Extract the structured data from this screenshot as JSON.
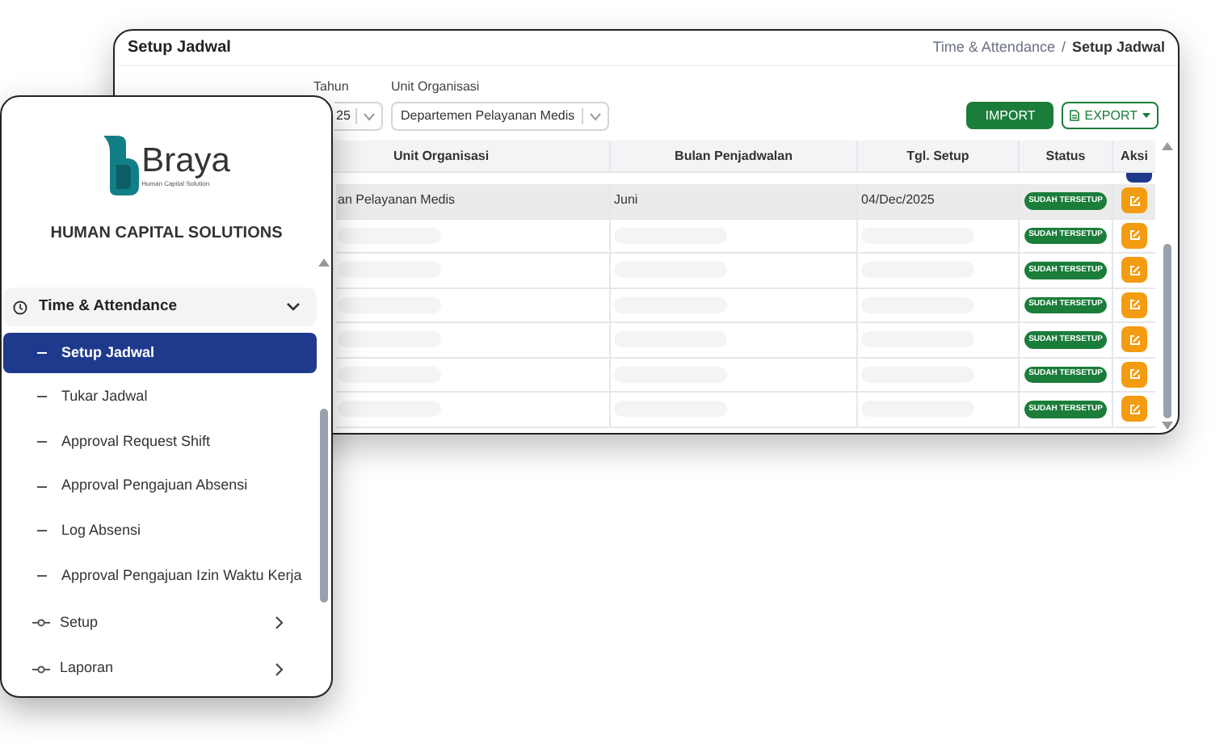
{
  "window": {
    "title": "Setup Jadwal"
  },
  "breadcrumb": {
    "items": [
      {
        "label": "Time & Attendance",
        "current": false
      },
      {
        "label": "Setup Jadwal",
        "current": true
      }
    ],
    "separator": "/"
  },
  "filters": [
    {
      "label": "Tahun",
      "value": "25"
    },
    {
      "label": "Unit Organisasi",
      "value": "Departemen Pelayanan Medis"
    }
  ],
  "actions": [
    {
      "kind": "import",
      "label": "IMPORT"
    },
    {
      "kind": "export",
      "label": "EXPORT"
    }
  ],
  "table": {
    "columns": [
      "Unit Organisasi",
      "Bulan Penjadwalan",
      "Tgl. Setup",
      "Status",
      "Aksi"
    ],
    "rows": [
      {
        "kind": "data",
        "cells": [
          "an Pelayanan Medis",
          "Juni",
          "04/Dec/2025"
        ],
        "status": "SUDAH TERSETUP",
        "selected": true
      },
      {
        "kind": "loading",
        "status": "SUDAH TERSETUP",
        "selected": false
      },
      {
        "kind": "loading",
        "status": "SUDAH TERSETUP",
        "selected": false
      },
      {
        "kind": "loading",
        "status": "SUDAH TERSETUP",
        "selected": false
      },
      {
        "kind": "loading",
        "status": "SUDAH TERSETUP",
        "selected": false
      },
      {
        "kind": "loading",
        "status": "SUDAH TERSETUP",
        "selected": false
      },
      {
        "kind": "loading",
        "status": "SUDAH TERSETUP",
        "selected": false
      }
    ]
  },
  "sidebar": {
    "brand": {
      "name": "Braya",
      "tagline": "Human Capital Solution"
    },
    "title": "HUMAN CAPITAL SOLUTIONS",
    "menu": [
      {
        "kind": "module",
        "label": "Time & Attendance",
        "expanded": true,
        "children": [
          {
            "label": "Setup Jadwal",
            "selected": true
          },
          {
            "label": "Tukar Jadwal",
            "selected": false
          },
          {
            "label": "Approval Request Shift",
            "selected": false
          },
          {
            "label": "Approval Pengajuan Absensi",
            "selected": false
          },
          {
            "label": "Log Absensi",
            "selected": false
          },
          {
            "label": "Approval Pengajuan Izin Waktu Kerja",
            "selected": false
          }
        ]
      },
      {
        "kind": "group",
        "label": "Setup",
        "expanded": false
      },
      {
        "kind": "group",
        "label": "Laporan",
        "expanded": false
      }
    ]
  }
}
